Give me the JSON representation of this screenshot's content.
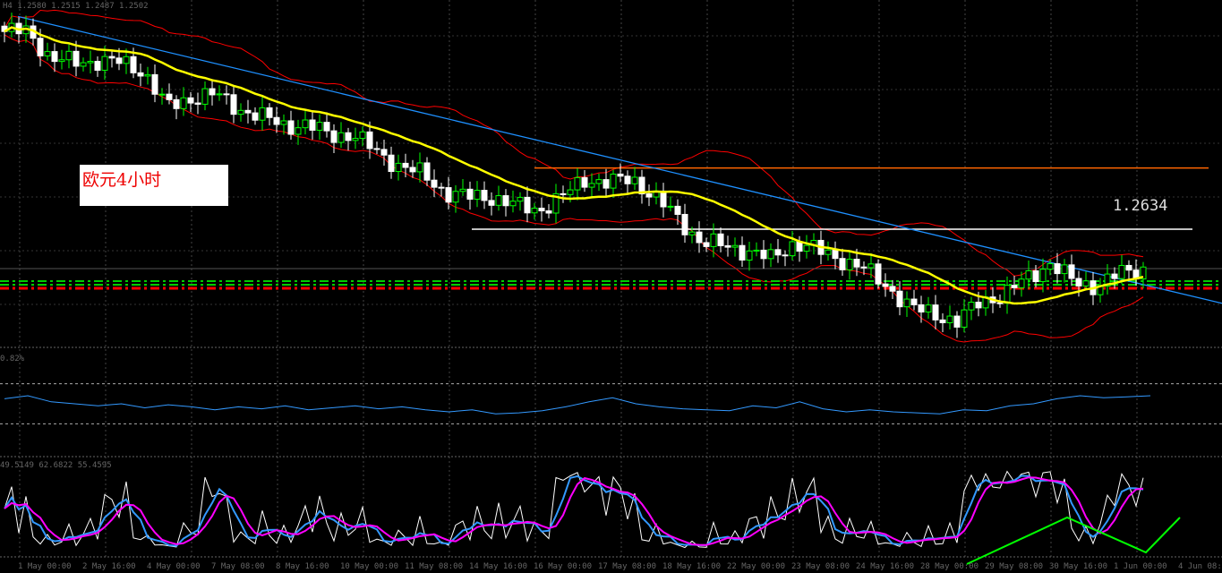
{
  "header": {
    "symbol_info": "H4 1.2580 1.2515 1.2487 1.2502"
  },
  "annotation": {
    "text": "欧元4小时"
  },
  "price_label": "1.2634",
  "indicator1_label": "0.82%",
  "indicator2_label": "49.5149 62.6822 55.4595",
  "time_axis": [
    "1 May 00:00",
    "2 May 16:00",
    "4 May 00:00",
    "7 May 08:00",
    "8 May 16:00",
    "10 May 00:00",
    "11 May 08:00",
    "14 May 16:00",
    "16 May 00:00",
    "17 May 08:00",
    "18 May 16:00",
    "22 May 00:00",
    "23 May 08:00",
    "24 May 16:00",
    "28 May 00:00",
    "29 May 08:00",
    "30 May 16:00",
    "1 Jun 00:00",
    "4 Jun 08:00"
  ],
  "colors": {
    "bg": "#000000",
    "bull": "#00ff00",
    "bear": "#ffffff",
    "ma": "#ffff00",
    "bands": "#ff0000",
    "trend": "#1e90ff",
    "resistance": "#ff6600",
    "support": "#ffffff",
    "stoch_main": "#ffffff",
    "stoch_k": "#3399ff",
    "stoch_d": "#ff00ff",
    "divergence": "#00ff00"
  },
  "chart_data": {
    "type": "candlestick",
    "title": "EURUSD H4",
    "closes": [
      1.2818,
      1.2818,
      1.2793,
      1.2789,
      1.2791,
      1.2789,
      1.2781,
      1.2747,
      1.2756,
      1.276,
      1.2747,
      1.2739,
      1.2731,
      1.2731,
      1.2722,
      1.2722,
      1.2706,
      1.2693,
      1.2685,
      1.2668,
      1.2664,
      1.2664,
      1.2656,
      1.2652,
      1.2664,
      1.2681,
      1.2677,
      1.2681,
      1.2664,
      1.2643,
      1.2622,
      1.2618,
      1.2614,
      1.2606,
      1.2622,
      1.2614,
      1.2606,
      1.2597,
      1.2581,
      1.256,
      1.2556,
      1.2547,
      1.2568,
      1.2572,
      1.2589,
      1.2602,
      1.2585,
      1.2581,
      1.2593,
      1.2597
    ],
    "ylim": [
      1.2527,
      1.284
    ],
    "horizontal_levels": [
      {
        "name": "resistance",
        "price": 1.2691
      },
      {
        "name": "support",
        "price": 1.2634
      },
      {
        "name": "current",
        "price": 1.2597
      }
    ],
    "trendline": {
      "start_price": 1.2832,
      "end_price": 1.2565
    },
    "indicator1": {
      "values": [
        55,
        58,
        52,
        50,
        48,
        50,
        46,
        49,
        47,
        44,
        47,
        45,
        48,
        44,
        46,
        48,
        45,
        47,
        44,
        42,
        44,
        40,
        41,
        43,
        47,
        52,
        56,
        50,
        47,
        45,
        44,
        43,
        48,
        46,
        52,
        45,
        42,
        44,
        42,
        41,
        40,
        44,
        43,
        48,
        50,
        55,
        58,
        56,
        57,
        58
      ],
      "levels": [
        70,
        30
      ]
    },
    "stochastic": {
      "levels": [
        80,
        20
      ]
    }
  }
}
